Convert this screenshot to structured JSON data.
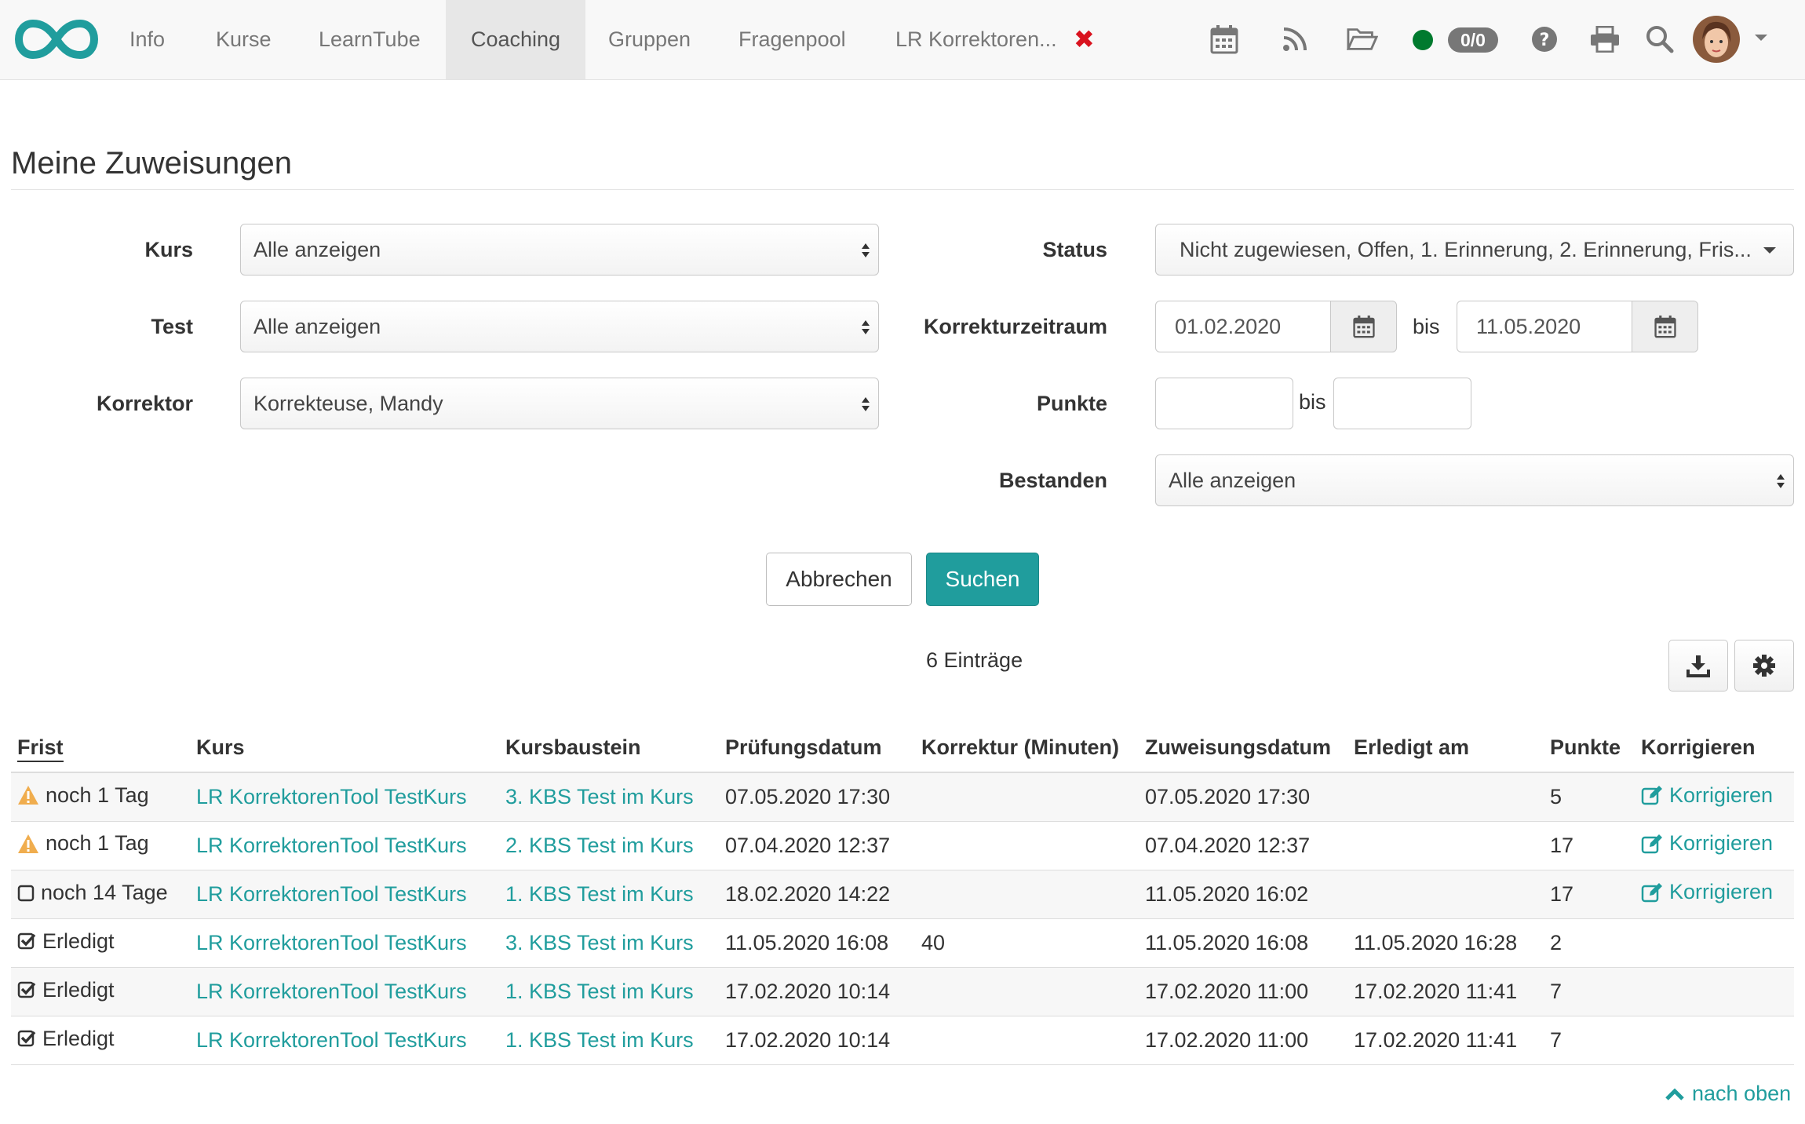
{
  "nav": {
    "items": [
      "Info",
      "Kurse",
      "LearnTube",
      "Coaching",
      "Gruppen",
      "Fragenpool",
      "LR Korrektoren..."
    ],
    "active": "Coaching",
    "close_icon": "close-icon",
    "badge": "0/0",
    "online_status_color": "#007a2e"
  },
  "page": {
    "title": "Meine Zuweisungen"
  },
  "filters": {
    "kurs_label": "Kurs",
    "kurs_value": "Alle anzeigen",
    "test_label": "Test",
    "test_value": "Alle anzeigen",
    "korrektor_label": "Korrektor",
    "korrektor_value": "Korrekteuse, Mandy",
    "status_label": "Status",
    "status_value": "Nicht zugewiesen, Offen, 1. Erinnerung, 2. Erinnerung, Fris...",
    "zeitraum_label": "Korrekturzeitraum",
    "zeitraum_from": "01.02.2020",
    "zeitraum_bis": "bis",
    "zeitraum_to": "11.05.2020",
    "punkte_label": "Punkte",
    "punkte_from": "",
    "punkte_bis": "bis",
    "punkte_to": "",
    "bestanden_label": "Bestanden",
    "bestanden_value": "Alle anzeigen"
  },
  "buttons": {
    "cancel": "Abbrechen",
    "search": "Suchen"
  },
  "table": {
    "count": "6 Einträge",
    "columns": [
      "Frist",
      "Kurs",
      "Kursbaustein",
      "Prüfungsdatum",
      "Korrektur (Minuten)",
      "Zuweisungsdatum",
      "Erledigt am",
      "Punkte",
      "Korrigieren"
    ],
    "rows": [
      {
        "frist": "noch 1 Tag",
        "frist_icon": "warning-icon",
        "kurs": "LR KorrektorenTool TestKurs",
        "baustein": "3. KBS Test im Kurs",
        "pruefung": "07.05.2020 17:30",
        "korrektur": "",
        "zuweisung": "07.05.2020 17:30",
        "erledigt": "",
        "punkte": "5",
        "korrigieren": "Korrigieren"
      },
      {
        "frist": "noch 1 Tag",
        "frist_icon": "warning-icon",
        "kurs": "LR KorrektorenTool TestKurs",
        "baustein": "2. KBS Test im Kurs",
        "pruefung": "07.04.2020 12:37",
        "korrektur": "",
        "zuweisung": "07.04.2020 12:37",
        "erledigt": "",
        "punkte": "17",
        "korrigieren": "Korrigieren"
      },
      {
        "frist": "noch 14 Tage",
        "frist_icon": "square-icon",
        "kurs": "LR KorrektorenTool TestKurs",
        "baustein": "1. KBS Test im Kurs",
        "pruefung": "18.02.2020 14:22",
        "korrektur": "",
        "zuweisung": "11.05.2020 16:02",
        "erledigt": "",
        "punkte": "17",
        "korrigieren": "Korrigieren"
      },
      {
        "frist": "Erledigt",
        "frist_icon": "checked-icon",
        "kurs": "LR KorrektorenTool TestKurs",
        "baustein": "3. KBS Test im Kurs",
        "pruefung": "11.05.2020 16:08",
        "korrektur": "40",
        "zuweisung": "11.05.2020 16:08",
        "erledigt": "11.05.2020 16:28",
        "punkte": "2",
        "korrigieren": ""
      },
      {
        "frist": "Erledigt",
        "frist_icon": "checked-icon",
        "kurs": "LR KorrektorenTool TestKurs",
        "baustein": "1. KBS Test im Kurs",
        "pruefung": "17.02.2020 10:14",
        "korrektur": "",
        "zuweisung": "17.02.2020 11:00",
        "erledigt": "17.02.2020 11:41",
        "punkte": "7",
        "korrigieren": ""
      },
      {
        "frist": "Erledigt",
        "frist_icon": "checked-icon",
        "kurs": "LR KorrektorenTool TestKurs",
        "baustein": "1. KBS Test im Kurs",
        "pruefung": "17.02.2020 10:14",
        "korrektur": "",
        "zuweisung": "17.02.2020 11:00",
        "erledigt": "17.02.2020 11:41",
        "punkte": "7",
        "korrigieren": ""
      }
    ]
  },
  "footer": {
    "to_top": "nach oben"
  },
  "colors": {
    "accent": "#209d9d",
    "warning": "#f0ad4e",
    "close": "#d9131f"
  }
}
